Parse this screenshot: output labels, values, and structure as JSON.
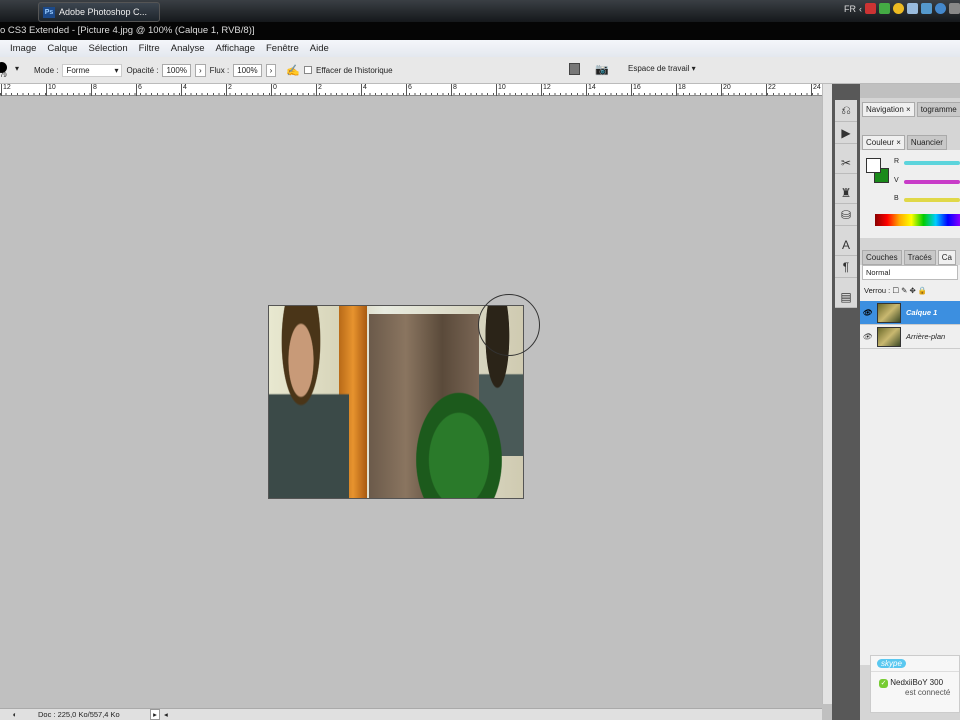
{
  "taskbar": {
    "task_label": "Adobe Photoshop C...",
    "lang": "FR"
  },
  "window": {
    "title": "o CS3 Extended - [Picture 4.jpg @ 100% (Calque 1, RVB/8)]"
  },
  "menu": [
    "Image",
    "Calque",
    "Sélection",
    "Filtre",
    "Analyse",
    "Affichage",
    "Fenêtre",
    "Aide"
  ],
  "options": {
    "brush_size": "79",
    "mode_label": "Mode :",
    "mode_value": "Forme",
    "opacity_label": "Opacité :",
    "opacity_value": "100%",
    "flux_label": "Flux :",
    "flux_value": "100%",
    "erase_history_label": "Effacer de l'historique",
    "workspace_label": "Espace de travail"
  },
  "ruler": [
    "12",
    "10",
    "8",
    "6",
    "4",
    "2",
    "0",
    "2",
    "4",
    "6",
    "8",
    "10",
    "12",
    "14",
    "16",
    "18",
    "20",
    "22",
    "24"
  ],
  "status": {
    "doc": "Doc : 225,0 Ko/557,4 Ko"
  },
  "panels": {
    "nav_tabs": [
      "Navigation ×",
      "togramme"
    ],
    "color_tabs": [
      "Couleur ×",
      "Nuancier"
    ],
    "channels": [
      "R",
      "V",
      "B"
    ],
    "layer_tabs": [
      "Couches",
      "Tracés",
      "Ca"
    ],
    "blend_mode": "Normal",
    "lock_label": "Verrou :",
    "layers": [
      {
        "name": "Calque 1",
        "selected": true
      },
      {
        "name": "Arrière-plan",
        "selected": false
      }
    ]
  },
  "skype": {
    "logo": "skype",
    "user": "NedxiiBoY 300",
    "status": "est connecté"
  },
  "colors": {
    "foreground": "#ffffff",
    "background": "#1a8a1a",
    "selection": "#3c8fe0"
  }
}
